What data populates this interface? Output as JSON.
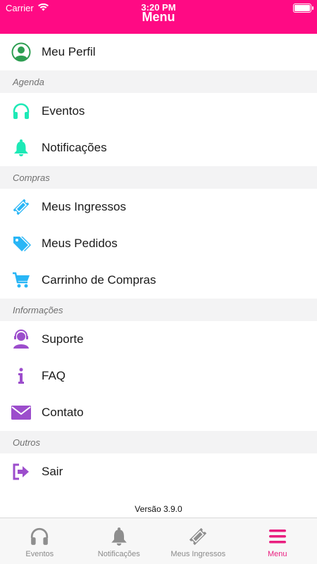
{
  "status": {
    "carrier": "Carrier",
    "time": "3:20 PM"
  },
  "header": {
    "title": "Menu"
  },
  "profile": {
    "label": "Meu Perfil"
  },
  "sections": {
    "agenda": "Agenda",
    "compras": "Compras",
    "informacoes": "Informações",
    "outros": "Outros"
  },
  "items": {
    "eventos": "Eventos",
    "notificacoes": "Notificações",
    "meus_ingressos": "Meus Ingressos",
    "meus_pedidos": "Meus Pedidos",
    "carrinho": "Carrinho de Compras",
    "suporte": "Suporte",
    "faq": "FAQ",
    "contato": "Contato",
    "sair": "Sair"
  },
  "footer": {
    "version": "Versão 3.9.0"
  },
  "tabbar": {
    "tabs": [
      {
        "label": "Eventos"
      },
      {
        "label": "Notificações"
      },
      {
        "label": "Meus Ingressos"
      },
      {
        "label": "Menu"
      }
    ],
    "active": "Menu"
  },
  "colors": {
    "header_bg": "#ff0a84",
    "active_tab": "#e91e7f",
    "profile_icon": "#2e9e52",
    "agenda_icons": "#1de9b6",
    "compras_icons": "#29b6f6",
    "info_icons": "#9c4dcc"
  },
  "icons": {
    "profile": "user-circle-icon",
    "eventos": "headphones-icon",
    "notificacoes": "bell-icon",
    "meus_ingressos": "ticket-icon",
    "meus_pedidos": "tags-icon",
    "carrinho": "cart-icon",
    "suporte": "support-agent-icon",
    "faq": "info-icon",
    "contato": "envelope-icon",
    "sair": "sign-out-icon"
  }
}
